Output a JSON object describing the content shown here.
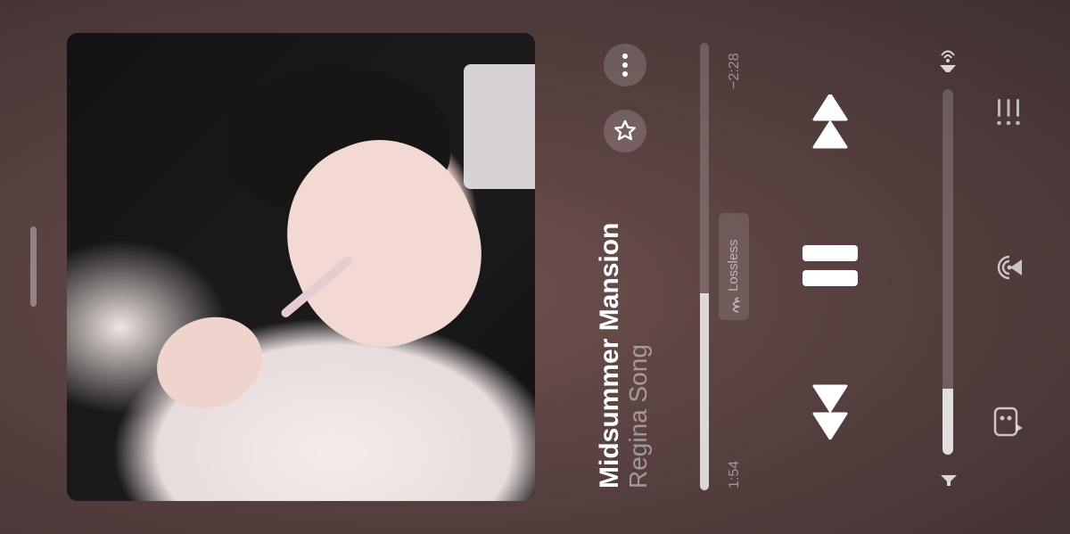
{
  "track": {
    "title": "Midsummer Mansion",
    "artist": "Regina Song",
    "elapsed": "1:54",
    "remaining": "−2:28",
    "progress_fraction": 0.44,
    "quality_badge": "Lossless"
  },
  "volume": {
    "level_fraction": 0.18
  },
  "icons": {
    "more": "more-icon",
    "favorite": "star-icon",
    "previous": "previous-icon",
    "pause": "pause-icon",
    "next": "next-icon",
    "airplay": "airplay-icon",
    "volume_low": "volume-low-icon",
    "queue": "queue-icon",
    "airplay_device": "broadcast-icon",
    "lyrics": "lyrics-icon",
    "lossless": "lossless-icon"
  }
}
